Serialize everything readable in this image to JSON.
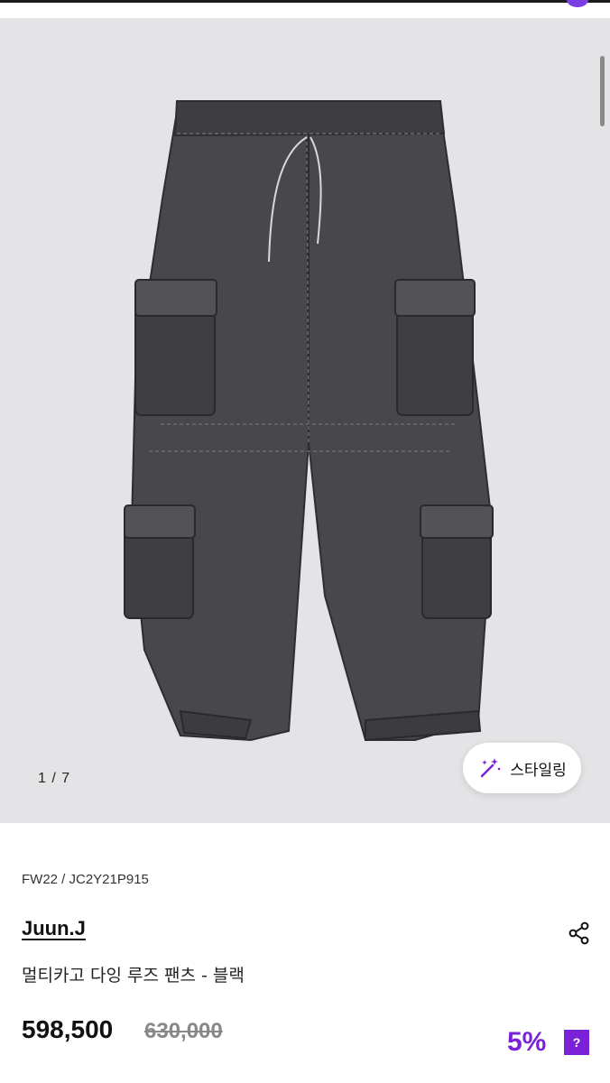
{
  "gallery": {
    "counter": "1 / 7",
    "styling_button_label": "스타일링",
    "image_alt": "multi-cargo dyed loose pants in black denim"
  },
  "product": {
    "season_code": "FW22 / JC2Y21P915",
    "brand": "Juun.J",
    "name": "멀티카고 다잉 루즈 팬츠 - 블랙",
    "price": "598,500",
    "original_price": "630,000",
    "discount": "5%",
    "help_label": "?"
  },
  "icons": {
    "styling": "magic-wand-icon",
    "share": "share-icon"
  },
  "colors": {
    "accent": "#7b22d9",
    "gallery_bg": "#e4e4e6",
    "denim": "#4b4b4f"
  }
}
